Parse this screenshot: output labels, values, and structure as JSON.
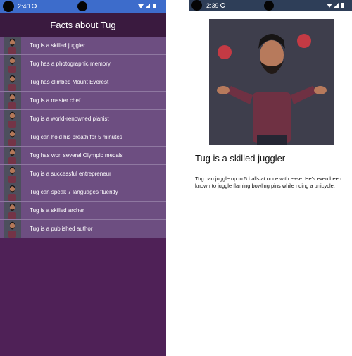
{
  "left_screen": {
    "status_time": "2:40",
    "app_title": "Facts about Tug",
    "facts": [
      {
        "label": "Tug is a skilled juggler"
      },
      {
        "label": "Tug has a photographic memory"
      },
      {
        "label": "Tug has climbed Mount Everest"
      },
      {
        "label": "Tug is a master chef"
      },
      {
        "label": "Tug is a world-renowned pianist"
      },
      {
        "label": "Tug can hold his breath for 5 minutes"
      },
      {
        "label": "Tug has won several Olympic medals"
      },
      {
        "label": "Tug is a successful entrepreneur"
      },
      {
        "label": "Tug can speak 7 languages fluently"
      },
      {
        "label": "Tug is a skilled archer"
      },
      {
        "label": "Tug is a published author"
      }
    ]
  },
  "right_screen": {
    "status_time": "2:39",
    "detail_title": "Tug is a skilled juggler",
    "detail_body": "Tug can juggle up to 5 balls at once with ease. He's even been known to juggle flaming bowling pins while riding a unicycle."
  },
  "icons": {
    "status": [
      "settings-gear-icon",
      "wifi-icon",
      "signal-icon",
      "battery-icon"
    ],
    "thumbnails": "bearded-man-portrait-icon"
  },
  "colors": {
    "left_status_bar": "#3d6ccb",
    "app_bar": "#3a1a3f",
    "list_background": "#6d4e81",
    "screen_background": "#4f2157",
    "right_status_bar": "#2e3e58"
  }
}
